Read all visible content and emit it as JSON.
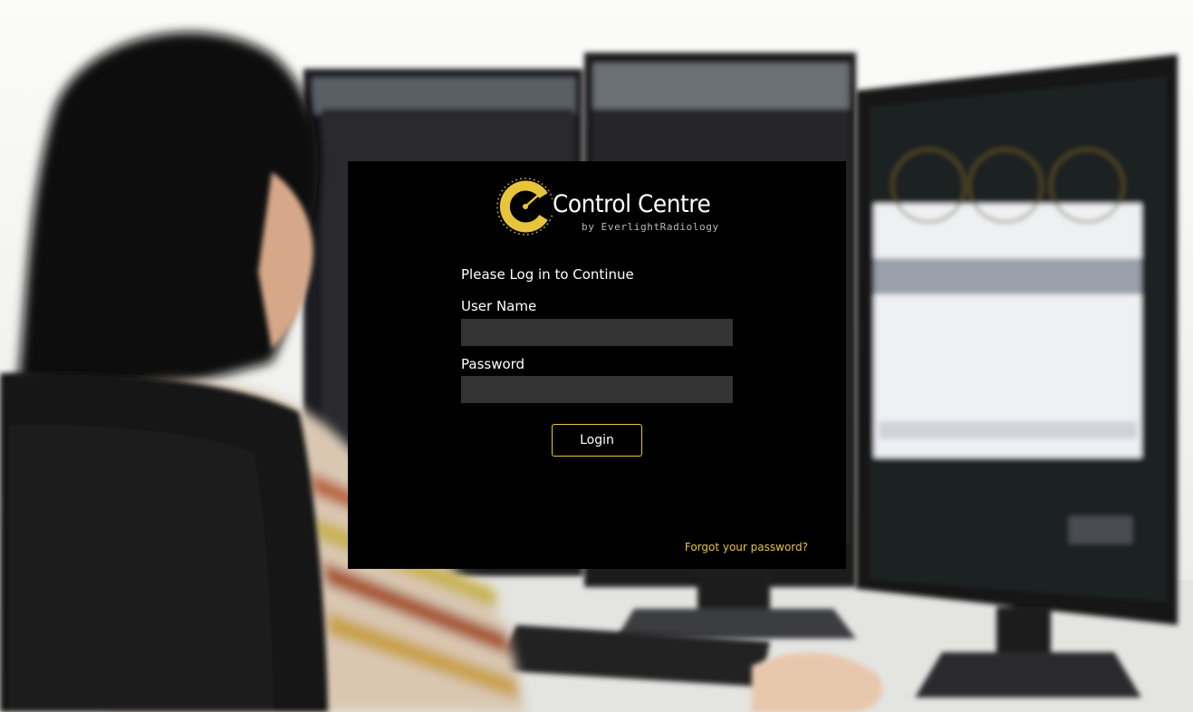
{
  "brand": {
    "name": "Control Centre",
    "subtitle": "by EverlightRadiology",
    "accent_color": "#e8c43a",
    "logo_icon": "gauge-c-icon"
  },
  "login_form": {
    "prompt": "Please Log in to Continue",
    "username_label": "User Name",
    "username_value": "",
    "password_label": "Password",
    "password_value": "",
    "login_button": "Login",
    "forgot_link": "Forgot your password?"
  },
  "colors": {
    "panel_background": "#000000",
    "field_background": "#333333",
    "text": "#ffffff"
  }
}
